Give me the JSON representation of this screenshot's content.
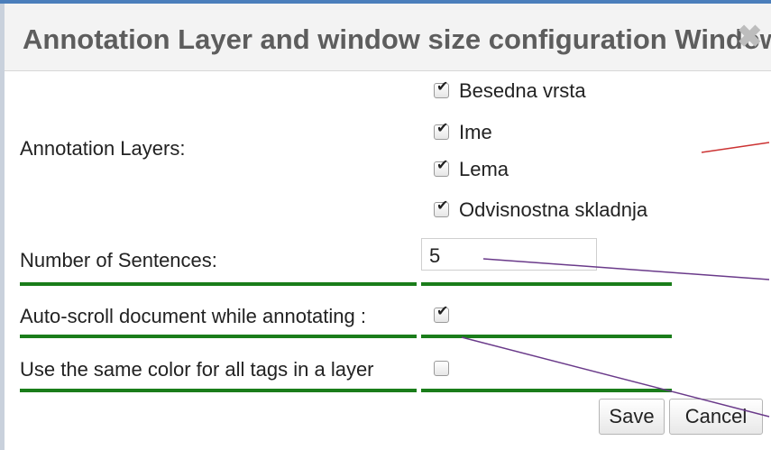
{
  "window": {
    "title": "Annotation Layer and window size configuration Window",
    "close_symbol": "✖"
  },
  "form": {
    "annotation_layers_label": "Annotation Layers:",
    "layers": [
      {
        "label": "Besedna vrsta",
        "checked": true
      },
      {
        "label": "Ime",
        "checked": true
      },
      {
        "label": "Lema",
        "checked": true
      },
      {
        "label": "Odvisnostna skladnja",
        "checked": true
      }
    ],
    "sentences_label": "Number of Sentences:",
    "sentences_value": "5",
    "autoscroll_label": "Auto-scroll document while annotating :",
    "autoscroll_checked": true,
    "samecolor_label": "Use the same color for all tags in a layer",
    "samecolor_checked": false,
    "check_symbol": "✔"
  },
  "buttons": {
    "save_label": "Save",
    "cancel_label": "Cancel"
  },
  "colors": {
    "title_bar": "#f3f3f3",
    "row_separator": "#1a7d1a",
    "arrow_red": "#cc3333",
    "arrow_purple": "#6a3a8a"
  }
}
